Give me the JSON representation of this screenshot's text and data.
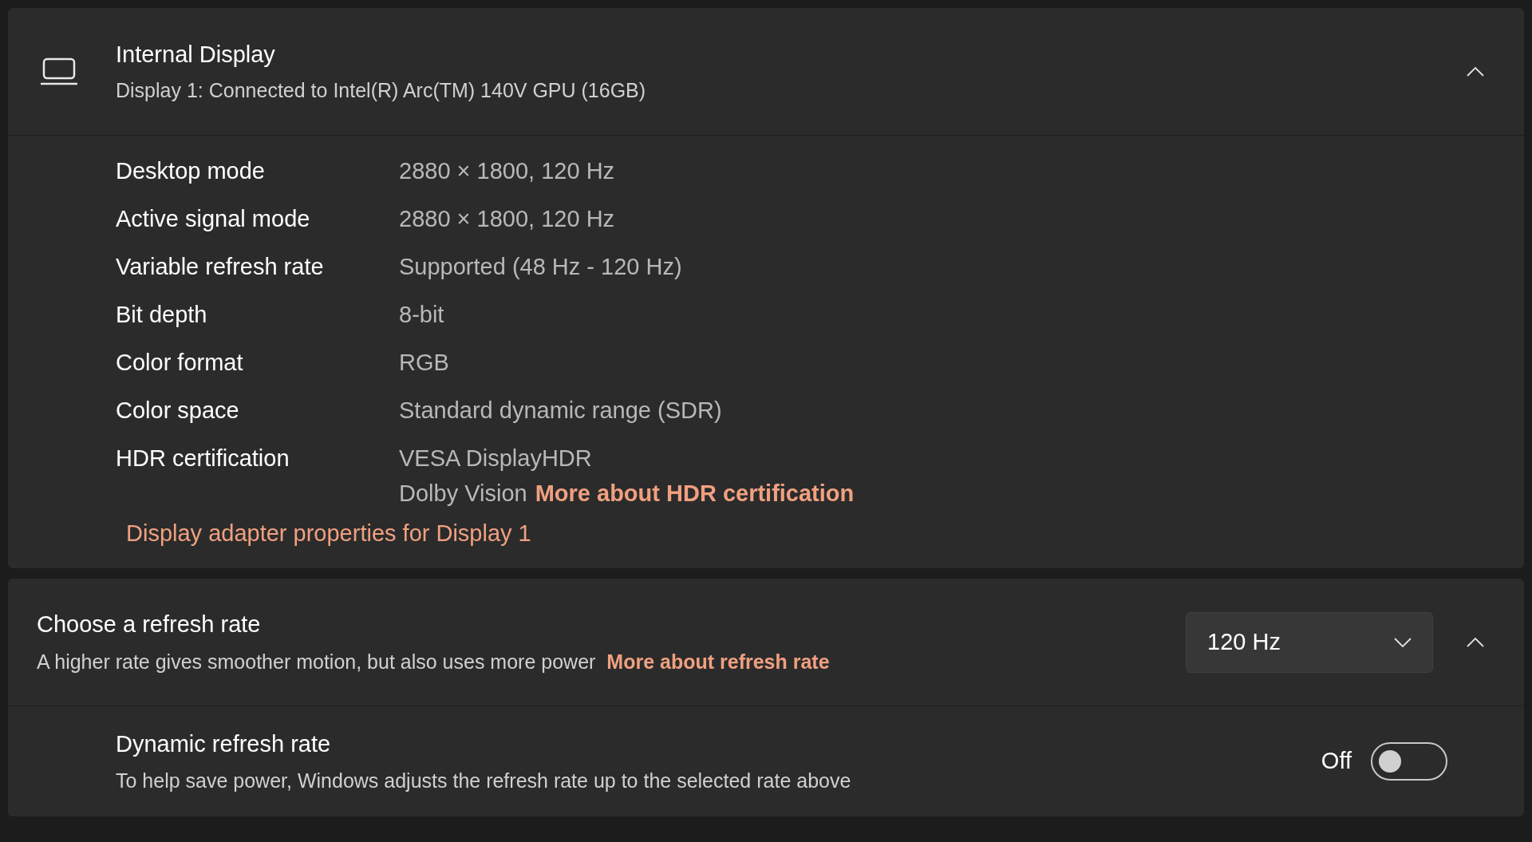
{
  "display_card": {
    "title": "Internal Display",
    "subtitle": "Display 1: Connected to Intel(R) Arc(TM) 140V GPU (16GB)",
    "expanded": true,
    "rows": [
      {
        "label": "Desktop mode",
        "values": [
          "2880 × 1800, 120 Hz"
        ]
      },
      {
        "label": "Active signal mode",
        "values": [
          "2880 × 1800, 120 Hz"
        ]
      },
      {
        "label": "Variable refresh rate",
        "values": [
          "Supported (48 Hz - 120 Hz)"
        ]
      },
      {
        "label": "Bit depth",
        "values": [
          "8-bit"
        ]
      },
      {
        "label": "Color format",
        "values": [
          "RGB"
        ]
      },
      {
        "label": "Color space",
        "values": [
          "Standard dynamic range (SDR)"
        ]
      },
      {
        "label": "HDR certification",
        "values": [
          "VESA DisplayHDR",
          "Dolby Vision"
        ],
        "link": "More about HDR certification"
      }
    ],
    "adapter_link": "Display adapter properties for Display 1"
  },
  "refresh_card": {
    "title": "Choose a refresh rate",
    "description": "A higher rate gives smoother motion, but also uses more power",
    "link": "More about refresh rate",
    "dropdown": {
      "value": "120 Hz"
    },
    "expanded": true,
    "dynamic": {
      "title": "Dynamic refresh rate",
      "description": "To help save power, Windows adjusts the refresh rate up to the selected rate above",
      "state_label": "Off",
      "on": false
    }
  }
}
